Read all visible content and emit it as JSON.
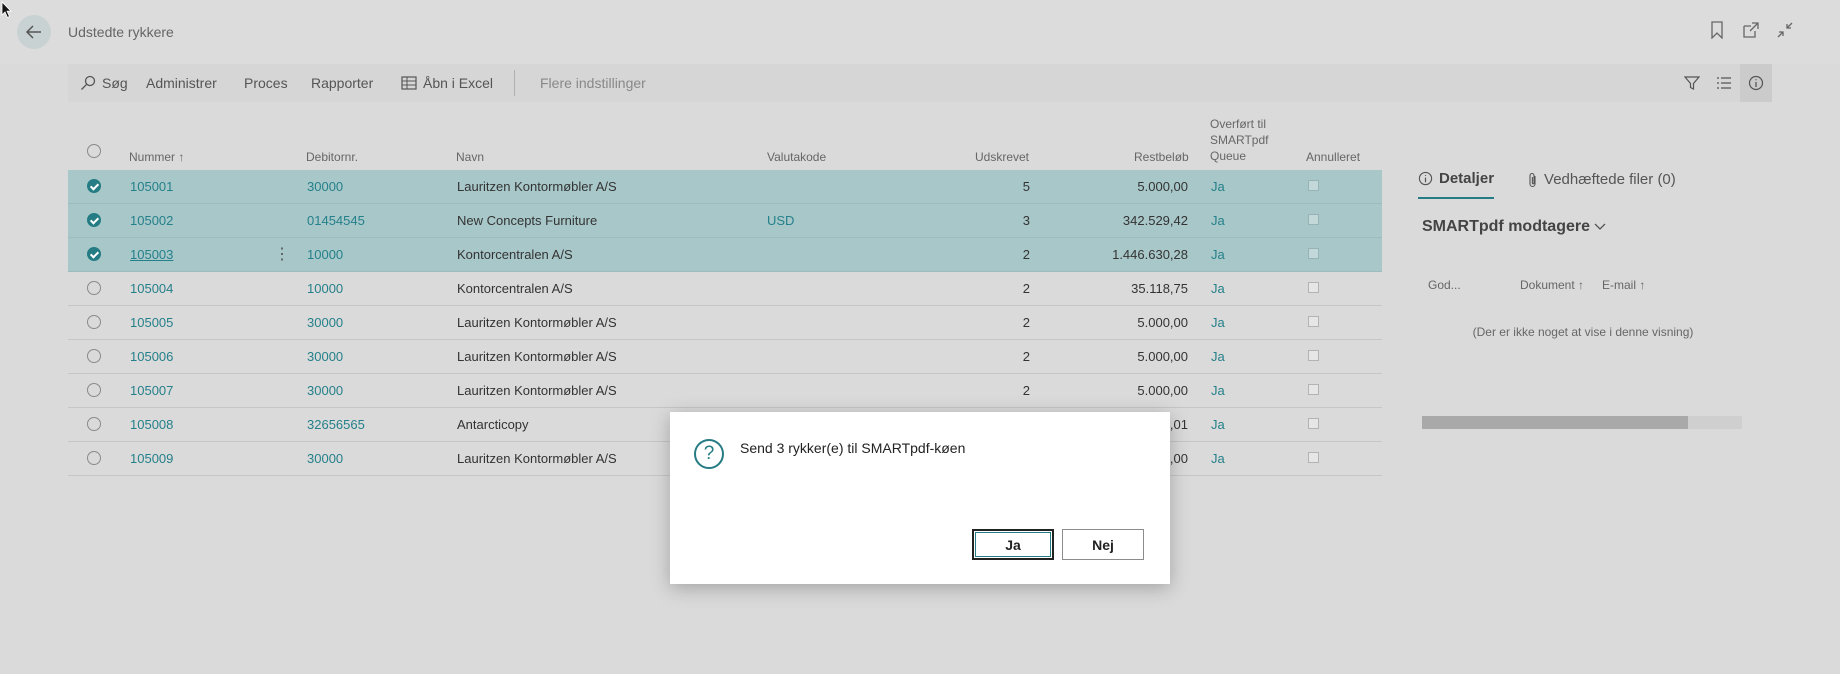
{
  "page": {
    "title": "Udstedte rykkere"
  },
  "toolbar": {
    "search": "Søg",
    "administrer": "Administrer",
    "proces": "Proces",
    "rapporter": "Rapporter",
    "excel": "Åbn i Excel",
    "more": "Flere indstillinger"
  },
  "columns": {
    "nummer": "Nummer ↑",
    "debitor": "Debitornr.",
    "navn": "Navn",
    "valuta": "Valutakode",
    "udskrevet": "Udskrevet",
    "restbelob": "Restbeløb",
    "overfort_1": "Overført til",
    "overfort_2": "SMARTpdf",
    "overfort_3": "Queue",
    "annulleret": "Annulleret"
  },
  "rows": [
    {
      "nummer": "105001",
      "debitor": "30000",
      "navn": "Lauritzen Kontormøbler A/S",
      "valuta": "",
      "udskrevet": "5",
      "restbelob": "5.000,00",
      "overfort": "Ja"
    },
    {
      "nummer": "105002",
      "debitor": "01454545",
      "navn": "New Concepts Furniture",
      "valuta": "USD",
      "udskrevet": "3",
      "restbelob": "342.529,42",
      "overfort": "Ja"
    },
    {
      "nummer": "105003",
      "debitor": "10000",
      "navn": "Kontorcentralen A/S",
      "valuta": "",
      "udskrevet": "2",
      "restbelob": "1.446.630,28",
      "overfort": "Ja"
    },
    {
      "nummer": "105004",
      "debitor": "10000",
      "navn": "Kontorcentralen A/S",
      "valuta": "",
      "udskrevet": "2",
      "restbelob": "35.118,75",
      "overfort": "Ja"
    },
    {
      "nummer": "105005",
      "debitor": "30000",
      "navn": "Lauritzen Kontormøbler A/S",
      "valuta": "",
      "udskrevet": "2",
      "restbelob": "5.000,00",
      "overfort": "Ja"
    },
    {
      "nummer": "105006",
      "debitor": "30000",
      "navn": "Lauritzen Kontormøbler A/S",
      "valuta": "",
      "udskrevet": "2",
      "restbelob": "5.000,00",
      "overfort": "Ja"
    },
    {
      "nummer": "105007",
      "debitor": "30000",
      "navn": "Lauritzen Kontormøbler A/S",
      "valuta": "",
      "udskrevet": "2",
      "restbelob": "5.000,00",
      "overfort": "Ja"
    },
    {
      "nummer": "105008",
      "debitor": "32656565",
      "navn": "Antarcticopy",
      "valuta": "",
      "udskrevet": "",
      "restbelob": ",01",
      "overfort": "Ja"
    },
    {
      "nummer": "105009",
      "debitor": "30000",
      "navn": "Lauritzen Kontormøbler A/S",
      "valuta": "",
      "udskrevet": "",
      "restbelob": ",00",
      "overfort": "Ja"
    }
  ],
  "factbox": {
    "tab_details": "Detaljer",
    "tab_attachments": "Vedhæftede filer (0)",
    "heading": "SMARTpdf modtagere",
    "col_god": "God...",
    "col_dokument": "Dokument ↑",
    "col_email": "E-mail ↑",
    "empty": "(Der er ikke noget at vise i denne visning)"
  },
  "dialog": {
    "message": "Send 3 rykker(e) til SMARTpdf-køen",
    "yes": "Ja",
    "no": "Nej"
  },
  "colors": {
    "accent": "#257c84",
    "selected_row": "#a8c7c9",
    "background": "#dadada"
  }
}
